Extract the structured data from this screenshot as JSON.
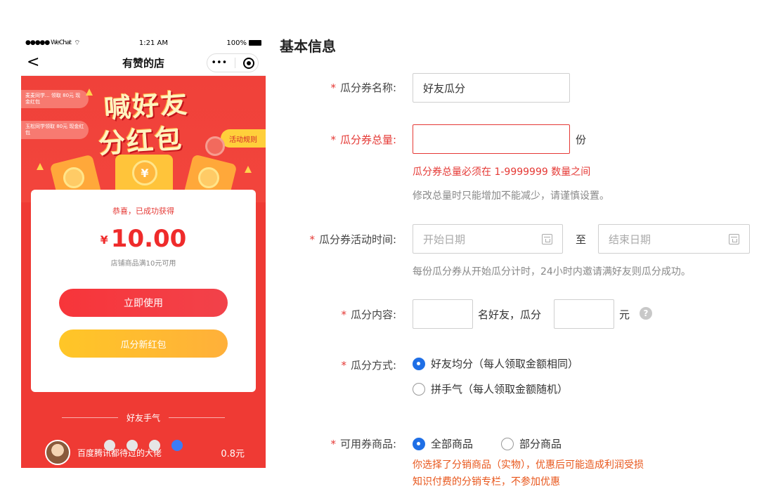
{
  "phone": {
    "status": {
      "carrier": "●●●●● WeChat",
      "time": "1:21 AM",
      "battery": "100%"
    },
    "nav": {
      "back": "<",
      "title": "有赞的店",
      "more": "•••"
    },
    "hero": {
      "title_line1": "喊好友",
      "title_line2": "分红包",
      "rules_button": "活动规则",
      "ticker1": "麦麦同学... 领取 80元 现金红包",
      "ticker2": "玉松同学领取 80元 现金红包",
      "coin_symbol": "¥"
    },
    "card": {
      "congrats": "恭喜，已成功获得",
      "currency": "¥",
      "amount": "10.00",
      "condition": "店铺商品满10元可用",
      "use_button": "立即使用",
      "split_button": "瓜分新红包"
    },
    "luck_section": {
      "title": "好友手气",
      "friend_name": "百度腾讯都待过的大佬",
      "friend_amount": "0.8元"
    }
  },
  "form": {
    "section_title": "基本信息",
    "name": {
      "label": "瓜分券名称:",
      "value": "好友瓜分"
    },
    "total": {
      "label": "瓜分券总量:",
      "value": "",
      "unit": "份",
      "error": "瓜分券总量必须在 1-9999999 数量之间",
      "hint": "修改总量时只能增加不能减少，请谨慎设置。"
    },
    "time": {
      "label": "瓜分券活动时间:",
      "start_placeholder": "开始日期",
      "to": "至",
      "end_placeholder": "结束日期",
      "hint": "每份瓜分券从开始瓜分计时，24小时内邀请满好友则瓜分成功。"
    },
    "content": {
      "label": "瓜分内容:",
      "friends_value": "",
      "friends_text": "名好友，瓜分",
      "amount_value": "",
      "unit": "元",
      "help": "?"
    },
    "method": {
      "label": "瓜分方式:",
      "option1": "好友均分（每人领取金额相同）",
      "option2": "拼手气（每人领取金额随机）"
    },
    "goods": {
      "label": "可用券商品:",
      "option1": "全部商品",
      "option2": "部分商品",
      "warning1": "你选择了分销商品（实物），优惠后可能造成利润受损",
      "warning2": "知识付费的分销专栏，不参加优惠"
    },
    "required_mark": "*"
  },
  "colors": {
    "accent_red": "#ef3a34",
    "error": "#e53935",
    "primary_blue": "#1f6fe6",
    "gold": "#ffc627"
  }
}
